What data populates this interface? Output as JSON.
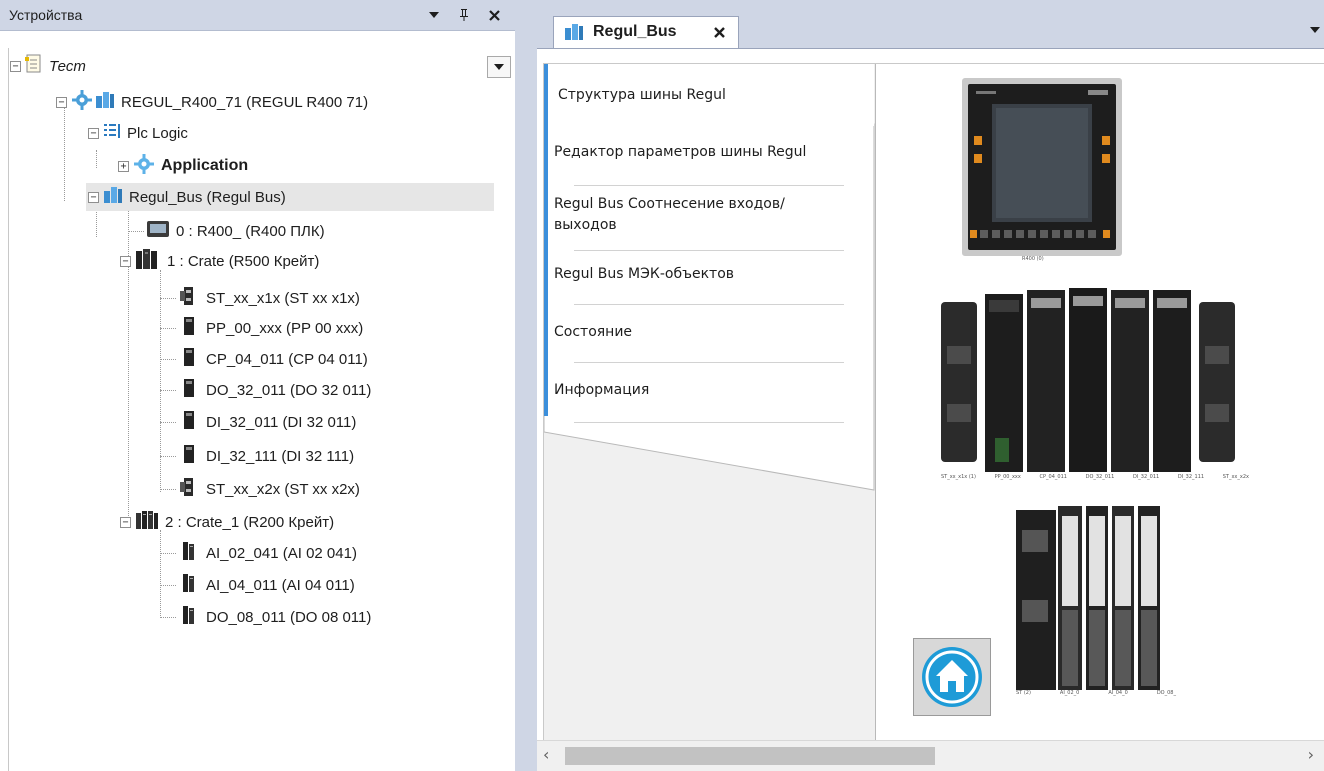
{
  "devices_panel": {
    "title": "Устройства",
    "header_buttons": {
      "dropdown_icon": "dropdown-triangle-icon",
      "pin_icon": "pin-icon",
      "close_icon": "close-icon"
    }
  },
  "tree": {
    "root": {
      "label": "Тест",
      "icon": "project-icon",
      "expanded": true
    },
    "plc": {
      "label": "REGUL_R400_71 (REGUL R400 71)",
      "icon": "plc-device-icon",
      "expanded": true
    },
    "plc_logic": {
      "label": "Plc Logic",
      "icon": "plc-logic-icon",
      "expanded": true
    },
    "application": {
      "label": "Application",
      "icon": "application-gear-icon",
      "expanded": false
    },
    "regul_bus": {
      "label": "Regul_Bus (Regul Bus)",
      "icon": "bus-icon",
      "expanded": true,
      "selected": true
    },
    "r400": {
      "label": "0 : R400_ (R400 ПЛК)",
      "icon": "controller-module-icon"
    },
    "crate": {
      "label": "1 : Crate (R500 Крейт)",
      "icon": "crate-icon",
      "expanded": true
    },
    "crate_items": [
      {
        "label": "ST_xx_x1x (ST xx x1x)",
        "icon": "module-io-icon"
      },
      {
        "label": "PP_00_xxx (PP 00 xxx)",
        "icon": "module-icon"
      },
      {
        "label": "CP_04_011 (CP 04 011)",
        "icon": "module-icon"
      },
      {
        "label": "DO_32_011 (DO 32 011)",
        "icon": "module-icon"
      },
      {
        "label": "DI_32_011 (DI 32 011)",
        "icon": "module-icon"
      },
      {
        "label": "DI_32_111 (DI 32 111)",
        "icon": "module-icon"
      },
      {
        "label": "ST_xx_x2x (ST xx x2x)",
        "icon": "module-io-icon"
      }
    ],
    "crate_1": {
      "label": "2 : Crate_1 (R200 Крейт)",
      "icon": "crate-r200-icon",
      "expanded": true
    },
    "crate_1_items": [
      {
        "label": "AI_02_041 (AI 02 041)",
        "icon": "module-r200-icon"
      },
      {
        "label": "AI_04_011 (AI 04 011)",
        "icon": "module-r200-icon"
      },
      {
        "label": "DO_08_011 (DO 08 011)",
        "icon": "module-r200-icon"
      }
    ]
  },
  "editor": {
    "tab": {
      "label": "Regul_Bus",
      "icon": "bus-icon",
      "close": "×"
    },
    "vertical_tabs": [
      {
        "label": "Структура шины Regul",
        "active": true
      },
      {
        "label": "Редактор параметров шины Regul"
      },
      {
        "label": "Regul Bus Соотнесение входов/выходов"
      },
      {
        "label": "Regul Bus МЭК-объектов"
      },
      {
        "label": "Состояние"
      },
      {
        "label": "Информация"
      }
    ],
    "images": {
      "r400_panel": {
        "caption": "R400 (0)",
        "icon": "r400-panel-image"
      },
      "r500_crate": {
        "captions": [
          "ST_xx_x1x (1)",
          "PP_00_xxx",
          "CP_04_011",
          "DO_32_011",
          "DI_32_011",
          "DI_32_111",
          "ST_xx_x2x"
        ],
        "icon": "r500-crate-image"
      },
      "r200_crate": {
        "captions": [
          "ST (2)",
          "AI_02_0",
          "AI_04_0",
          "DO_08_"
        ],
        "icon": "r200-crate-image"
      }
    },
    "home_button": {
      "icon": "home-icon"
    },
    "hscroll": {
      "left_arrow": "‹",
      "right_arrow": "›"
    }
  },
  "colors": {
    "header_bg": "#cfd6e5",
    "accent_blue": "#3c8fdb",
    "selection_bg": "#e6e6e6"
  }
}
